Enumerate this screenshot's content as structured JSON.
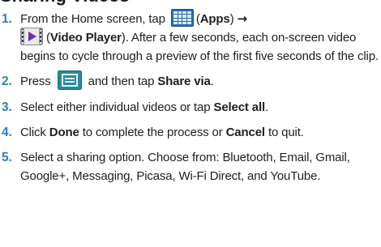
{
  "heading": "Sharing Videos",
  "steps": [
    {
      "number": "1.",
      "parts": {
        "a": "From the Home screen, tap",
        "b_open": "(",
        "apps_label": "Apps",
        "b_close": ")",
        "arrow": "→",
        "c_open": "(",
        "video_player_label": "Video Player",
        "c_rest": "). After a few seconds, each on-screen video begins to cycle through a preview of the first five seconds of the clip."
      },
      "icons": [
        "apps-grid-icon",
        "video-player-icon"
      ]
    },
    {
      "number": "2.",
      "parts": {
        "a": "Press",
        "b": "and then tap",
        "share_via_label": "Share via",
        "end": "."
      },
      "icons": [
        "menu-key-icon"
      ]
    },
    {
      "number": "3.",
      "parts": {
        "a": "Select either individual videos or tap",
        "select_all_label": "Select all",
        "end": "."
      }
    },
    {
      "number": "4.",
      "parts": {
        "a": "Click",
        "done_label": "Done",
        "b": "to complete the process or",
        "cancel_label": "Cancel",
        "c": "to quit."
      }
    },
    {
      "number": "5.",
      "text": "Select a sharing option. Choose from: Bluetooth, Email, Gmail, Google+, Messaging, Picasa, Wi-Fi Direct, and YouTube."
    }
  ],
  "colors": {
    "step_number": "#2a7fbf",
    "apps_icon_bg": "#2a6db0",
    "video_icon_play": "#6a2fb0",
    "menu_icon": "#2a8a9c"
  }
}
